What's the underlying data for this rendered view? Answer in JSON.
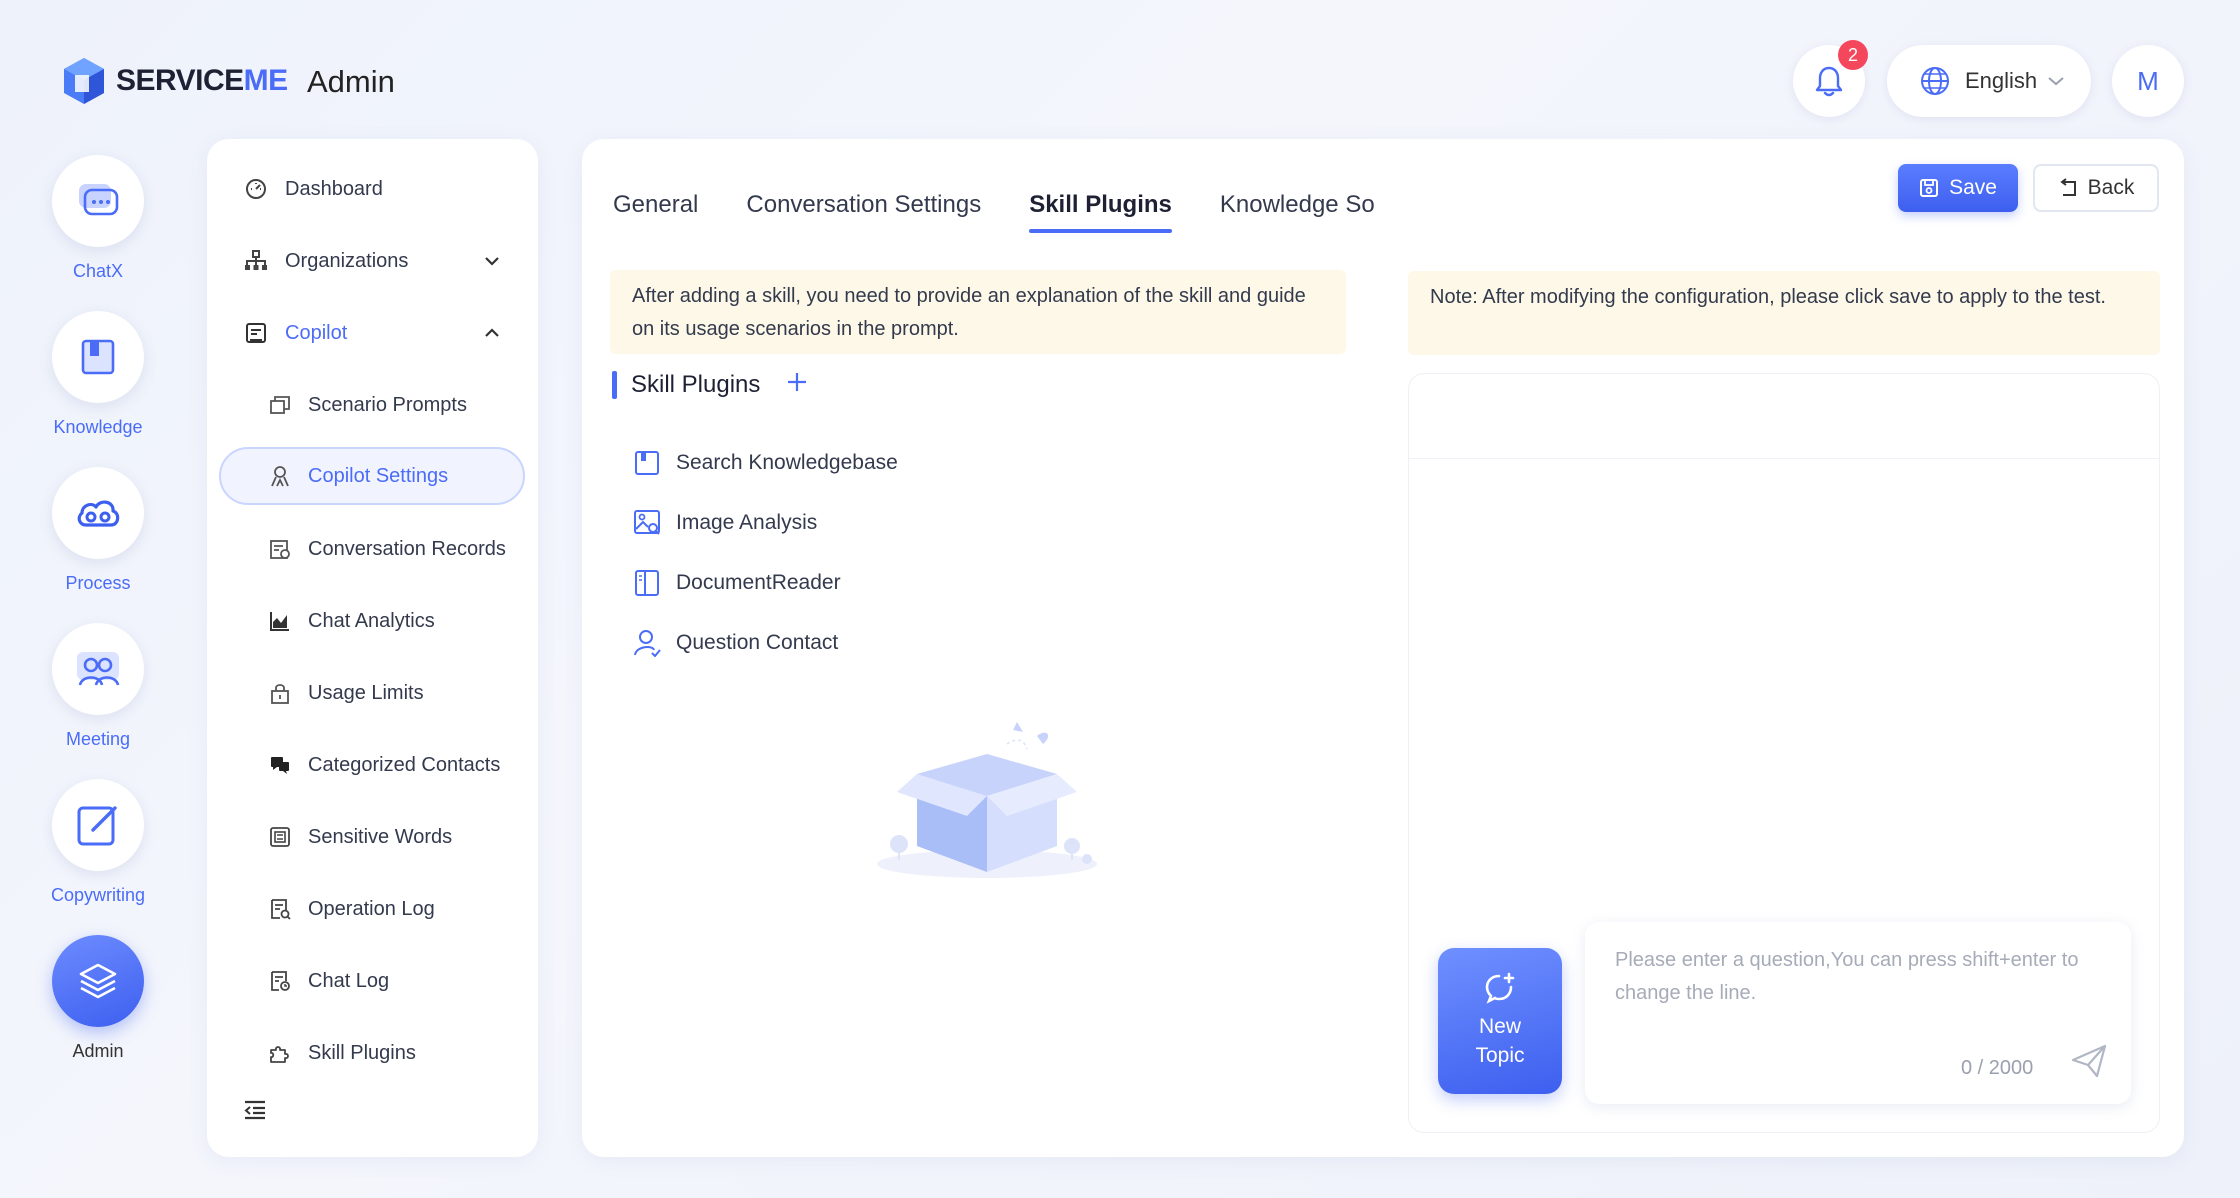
{
  "header": {
    "logo_prefix": "SERVICE",
    "logo_suffix": "ME",
    "title": "Admin",
    "notification_count": "2",
    "language": "English",
    "avatar_initial": "M"
  },
  "rail": [
    {
      "label": "ChatX",
      "icon": "chat-bubble-icon"
    },
    {
      "label": "Knowledge",
      "icon": "book-icon"
    },
    {
      "label": "Process",
      "icon": "cloud-flow-icon"
    },
    {
      "label": "Meeting",
      "icon": "people-icon"
    },
    {
      "label": "Copywriting",
      "icon": "edit-icon"
    },
    {
      "label": "Admin",
      "icon": "layers-icon",
      "active": true
    }
  ],
  "subnav": {
    "items": [
      {
        "label": "Dashboard",
        "icon": "dashboard-icon"
      },
      {
        "label": "Organizations",
        "icon": "org-tree-icon"
      },
      {
        "label": "Copilot",
        "icon": "copilot-icon"
      },
      {
        "label": "Scenario Prompts",
        "icon": "prompts-icon"
      },
      {
        "label": "Copilot Settings",
        "icon": "user-settings-icon",
        "selected": true
      },
      {
        "label": "Conversation Records",
        "icon": "records-icon"
      },
      {
        "label": "Chat Analytics",
        "icon": "chart-icon"
      },
      {
        "label": "Usage Limits",
        "icon": "lock-icon"
      },
      {
        "label": "Categorized Contacts",
        "icon": "contacts-icon"
      },
      {
        "label": "Sensitive Words",
        "icon": "words-icon"
      },
      {
        "label": "Operation Log",
        "icon": "log-icon"
      },
      {
        "label": "Chat Log",
        "icon": "chat-log-icon"
      },
      {
        "label": "Skill Plugins",
        "icon": "puzzle-icon"
      }
    ]
  },
  "main": {
    "tabs": [
      {
        "label": "General"
      },
      {
        "label": "Conversation Settings"
      },
      {
        "label": "Skill Plugins",
        "active": true
      },
      {
        "label": "Knowledge So"
      }
    ],
    "save_label": "Save",
    "back_label": "Back",
    "left_notice": "After adding a skill, you need to provide an explanation of the skill and guide on its usage scenarios in the prompt.",
    "right_notice": "Note: After modifying the configuration, please click save to apply to the test.",
    "section_title": "Skill Plugins",
    "plugins": [
      {
        "label": "Search Knowledgebase",
        "icon": "knowledgebase-icon"
      },
      {
        "label": "Image Analysis",
        "icon": "image-analysis-icon"
      },
      {
        "label": "DocumentReader",
        "icon": "document-reader-icon"
      },
      {
        "label": "Question Contact",
        "icon": "contact-icon"
      }
    ],
    "chat": {
      "new_topic_label": "New Topic",
      "input_placeholder": "Please enter a question,You can press shift+enter to change the line.",
      "input_value": "",
      "counter": "0 / 2000"
    }
  },
  "colors": {
    "accent": "#4a6cf7",
    "notice_bg": "#fdf8e7",
    "badge": "#f5475c"
  }
}
